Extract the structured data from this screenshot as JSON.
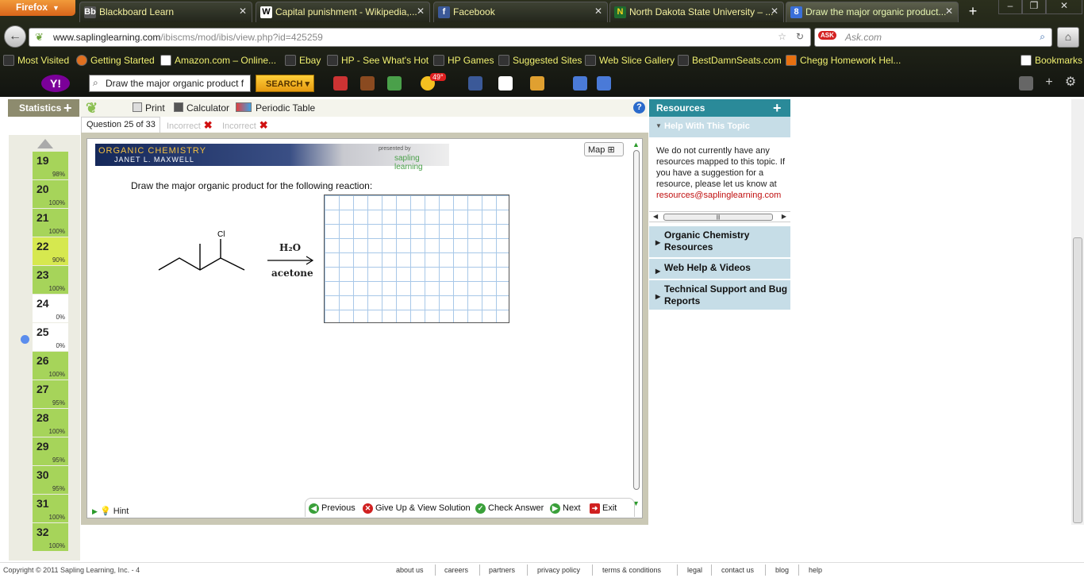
{
  "browser": {
    "menu_label": "Firefox",
    "tabs": [
      {
        "title": "Blackboard Learn",
        "icon": "blackboard-icon"
      },
      {
        "title": "Capital punishment - Wikipedia,...",
        "icon": "wikipedia-icon"
      },
      {
        "title": "Facebook",
        "icon": "facebook-icon"
      },
      {
        "title": "North Dakota State University – ...",
        "icon": "ndsu-icon"
      },
      {
        "title": "Draw the major organic product...",
        "icon": "google-icon"
      }
    ],
    "active_tab_index": 4,
    "url_host": "www.saplinglearning.com",
    "url_path": "/ibiscms/mod/ibis/view.php?id=425259",
    "search_placeholder": "Ask.com"
  },
  "bookmarks": [
    "Most Visited",
    "Getting Started",
    "Amazon.com – Online...",
    "Ebay",
    "HP - See What's Hot",
    "HP Games",
    "Suggested Sites",
    "Web Slice Gallery",
    "BestDamnSeats.com",
    "Chegg Homework Hel...",
    "Bookmarks"
  ],
  "yahoo_toolbar": {
    "search_value": "Draw the major organic product f",
    "search_button": "SEARCH",
    "temperature": "49°"
  },
  "toolbar": {
    "statistics": "Statistics",
    "print": "Print",
    "calculator": "Calculator",
    "periodic_table": "Periodic Table"
  },
  "question_tabs": [
    {
      "label": "Question 25 of 33"
    },
    {
      "label": "Incorrect"
    },
    {
      "label": "Incorrect"
    }
  ],
  "questions": [
    {
      "num": "19",
      "pct": "98%",
      "status": "green"
    },
    {
      "num": "20",
      "pct": "100%",
      "status": "green"
    },
    {
      "num": "21",
      "pct": "100%",
      "status": "green"
    },
    {
      "num": "22",
      "pct": "90%",
      "status": "yellow"
    },
    {
      "num": "23",
      "pct": "100%",
      "status": "green"
    },
    {
      "num": "24",
      "pct": "0%",
      "status": "white"
    },
    {
      "num": "25",
      "pct": "0%",
      "status": "white"
    },
    {
      "num": "26",
      "pct": "100%",
      "status": "green"
    },
    {
      "num": "27",
      "pct": "95%",
      "status": "green"
    },
    {
      "num": "28",
      "pct": "100%",
      "status": "green"
    },
    {
      "num": "29",
      "pct": "95%",
      "status": "green"
    },
    {
      "num": "30",
      "pct": "95%",
      "status": "green"
    },
    {
      "num": "31",
      "pct": "100%",
      "status": "green"
    },
    {
      "num": "32",
      "pct": "100%",
      "status": "green"
    }
  ],
  "current_question": "25",
  "banner": {
    "title": "Organic Chemistry",
    "author": "Janet L. Maxwell",
    "presented_by": "presented by",
    "brand": "sapling learning"
  },
  "map_label": "Map",
  "prompt": "Draw the major organic product for the following reaction:",
  "reaction": {
    "reactant_label": "Cl",
    "reagent_top": "H₂O",
    "reagent_bottom": "acetone"
  },
  "hint_label": "Hint",
  "actions": {
    "previous": "Previous",
    "give_up": "Give Up & View Solution",
    "check": "Check Answer",
    "next": "Next",
    "exit": "Exit"
  },
  "resources": {
    "title": "Resources",
    "help_topic": "Help With This Topic",
    "message": "We do not currently have any resources mapped to this topic. If you have a suggestion for a resource, please let us know at",
    "email": "resources@saplinglearning.com",
    "sections": [
      "Organic Chemistry Resources",
      "Web Help & Videos",
      "Technical Support and Bug Reports"
    ]
  },
  "footer": {
    "copyright": "Copyright © 2011 Sapling Learning, Inc. - 4",
    "links": [
      "about us",
      "careers",
      "partners",
      "privacy policy",
      "terms & conditions",
      "legal",
      "contact us",
      "blog",
      "help"
    ]
  },
  "colors": {
    "accent_teal": "#2a8a99",
    "question_green": "#a6d45a",
    "question_yellow": "#d6e84f",
    "incorrect_red": "#d01010"
  }
}
